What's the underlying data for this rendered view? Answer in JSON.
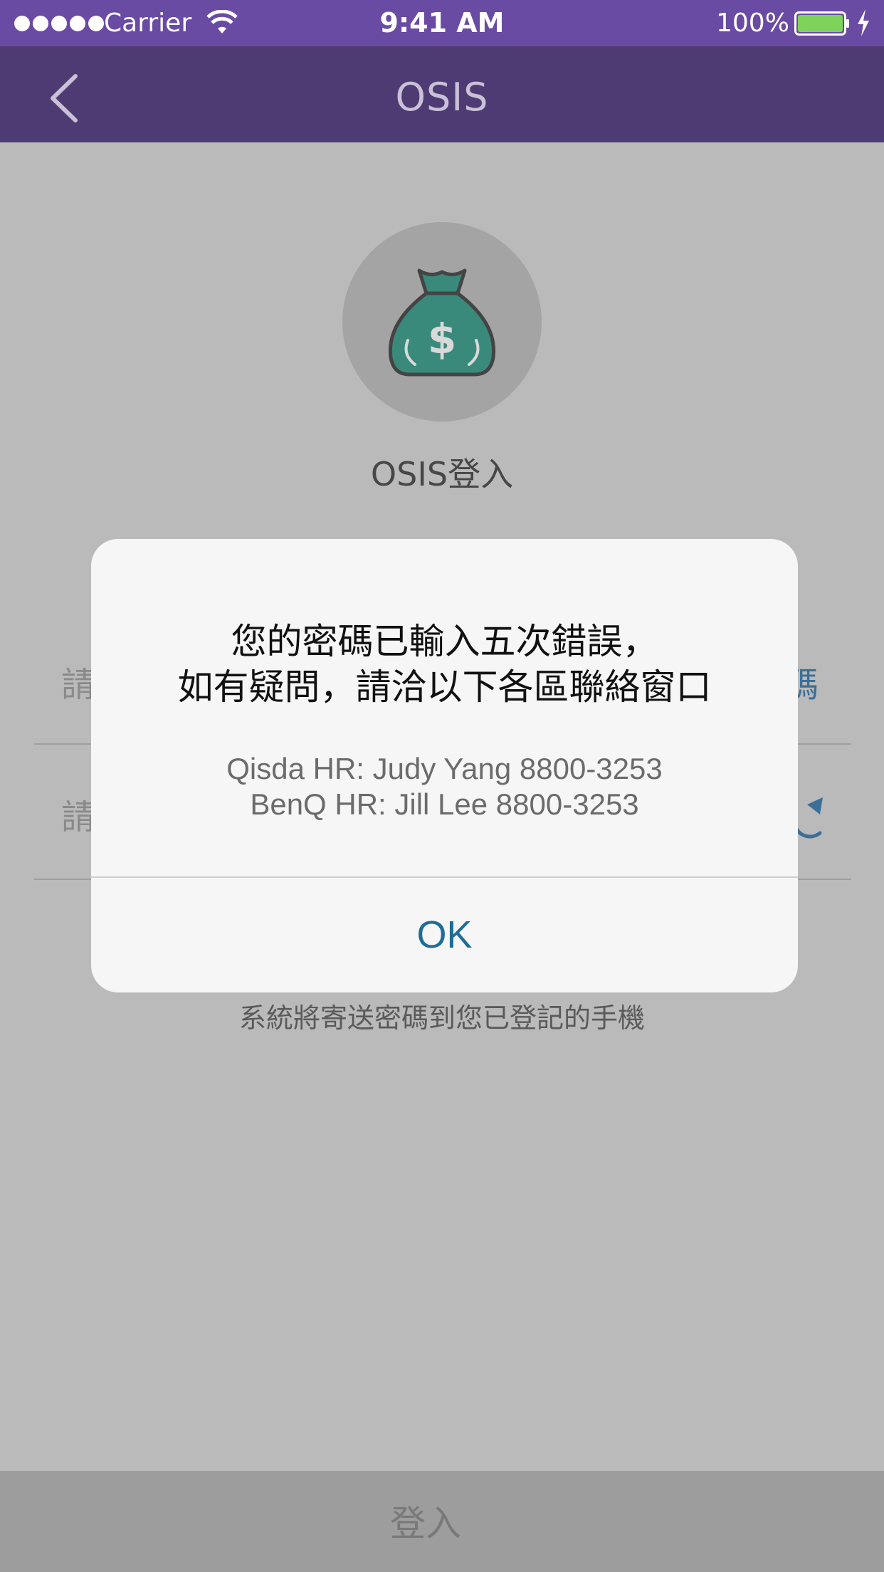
{
  "status_bar": {
    "carrier": "Carrier",
    "time": "9:41 AM",
    "battery": "100%",
    "icons": [
      "signal-dots-icon",
      "wifi-icon",
      "battery-icon",
      "charging-bolt-icon"
    ]
  },
  "nav": {
    "title": "OSIS",
    "back_icon": "chevron-left-icon"
  },
  "login_page": {
    "logo_icon": "money-bag-icon",
    "title": "OSIS登入",
    "field_prefix_1": "請",
    "field_link_suffix": "碼",
    "field_prefix_2": "請",
    "refresh_icon": "refresh-icon",
    "hint_line": "系統將寄送密碼到您已登記的手機",
    "login_button": "登入"
  },
  "alert": {
    "message_line_1": "您的密碼已輸入五次錯誤，",
    "message_line_2": "如有疑問，請洽以下各區聯絡窗口",
    "contact_1": "Qisda HR: Judy Yang 8800-3253",
    "contact_2": "BenQ HR: Jill Lee 8800-3253",
    "ok_label": "OK"
  },
  "colors": {
    "status_bar": "#6a4ba3",
    "nav_bar": "#4f3b74",
    "accent": "#1f6c98",
    "bag": "#3a8a7c"
  }
}
